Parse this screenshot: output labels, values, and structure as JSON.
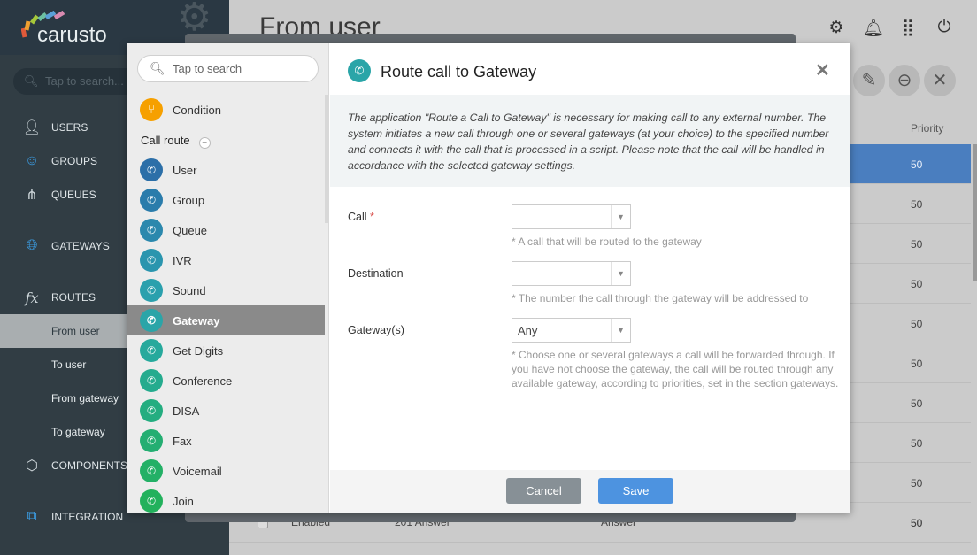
{
  "app": {
    "logo": "carusto",
    "page_title": "From user"
  },
  "sidebar": {
    "search_placeholder": "Tap to search...",
    "items": [
      {
        "label": "USERS",
        "icon": "user-icon"
      },
      {
        "label": "GROUPS",
        "icon": "groups-icon"
      },
      {
        "label": "QUEUES",
        "icon": "queues-icon"
      },
      {
        "label": "GATEWAYS",
        "icon": "globe-icon"
      },
      {
        "label": "ROUTES",
        "icon": "fx-icon"
      },
      {
        "label": "COMPONENTS",
        "icon": "cube-icon"
      },
      {
        "label": "INTEGRATION",
        "icon": "integration-icon"
      }
    ],
    "routes_sub": [
      "From user",
      "To user",
      "From gateway",
      "To gateway"
    ],
    "active_sub": "From user"
  },
  "table": {
    "priority_header": "Priority",
    "priorities": [
      "50",
      "50",
      "50",
      "50",
      "50",
      "50",
      "50",
      "50",
      "50",
      "50"
    ],
    "last_row": {
      "status": "Enabled",
      "name": "201 Answer",
      "action": "Answer",
      "priority": "50"
    }
  },
  "dialog": {
    "search_placeholder": "Tap to search",
    "condition_label": "Condition",
    "group_label": "Call route",
    "items": [
      "User",
      "Group",
      "Queue",
      "IVR",
      "Sound",
      "Gateway",
      "Get Digits",
      "Conference",
      "DISA",
      "Fax",
      "Voicemail",
      "Join"
    ],
    "selected": "Gateway",
    "title": "Route call to Gateway",
    "description": "The application \"Route a Call to Gateway\" is necessary for making call to any external number. The system initiates a new call through one or several gateways (at your choice) to the specified number and connects it with the call that is processed in a script. Please note that the call will be handled in accordance with the selected gateway settings.",
    "fields": [
      {
        "label": "Call",
        "required_mark": "*",
        "value": "",
        "hint": "* A call that will be routed to the gateway"
      },
      {
        "label": "Destination",
        "value": "",
        "hint": "* The number the call through the gateway will be addressed to"
      },
      {
        "label": "Gateway(s)",
        "value": "Any",
        "hint": "* Choose one or several gateways a call will be forwarded through. If you have not choose the gateway, the call will be routed through any available gateway, according to priorities, set in the section gateways."
      }
    ],
    "cancel_label": "Cancel",
    "save_label": "Save"
  },
  "colors": {
    "accent": "#4d93e0",
    "selected_row": "#4a7ebf",
    "sidebar": "#313d44"
  }
}
